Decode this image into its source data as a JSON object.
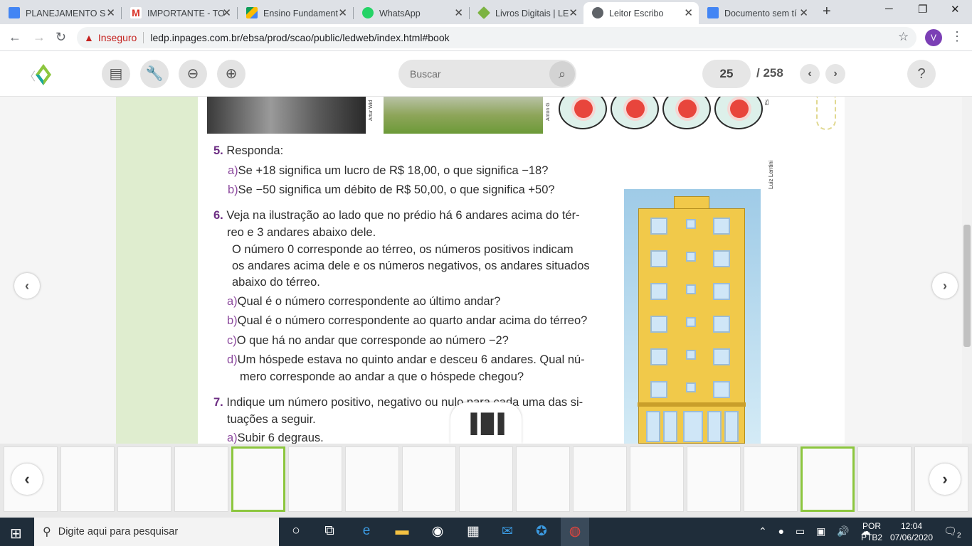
{
  "tabs": [
    {
      "title": "PLANEJAMENTO S",
      "favicon_color": "#4285f4",
      "active": false
    },
    {
      "title": "IMPORTANTE - TO",
      "favicon_color": "#d93025",
      "active": false
    },
    {
      "title": "Ensino Fundament",
      "favicon_color": "#fbbc04",
      "active": false
    },
    {
      "title": "WhatsApp",
      "favicon_color": "#25d366",
      "active": false
    },
    {
      "title": "Livros Digitais | LE",
      "favicon_color": "#7cb342",
      "active": false
    },
    {
      "title": "Leitor Escribo",
      "favicon_color": "#5f6368",
      "active": true
    },
    {
      "title": "Documento sem tí",
      "favicon_color": "#4285f4",
      "active": false
    }
  ],
  "address": {
    "security_label": "Inseguro",
    "url": "ledp.inpages.com.br/ebsa/prod/scao/public/ledweb/index.html#book",
    "avatar_letter": "V"
  },
  "reader_toolbar": {
    "search_placeholder": "Buscar",
    "current_page": "25",
    "total_pages": "/ 258",
    "help_label": "?"
  },
  "page": {
    "credits": {
      "photo1": "Artur Wid",
      "photo2": "Anton G",
      "photo3": "Es",
      "building": "Luiz Lentini"
    },
    "q5": {
      "number": "5.",
      "text": "Responda:",
      "a": {
        "letter": "a)",
        "text": "Se +18 significa um lucro de R$ 18,00, o que significa −18?"
      },
      "b": {
        "letter": "b)",
        "text": "Se −50 significa um débito de R$ 50,00, o que significa +50?"
      }
    },
    "q6": {
      "number": "6.",
      "line1": "Veja na ilustração ao lado que no prédio há 6 andares acima do tér-",
      "line2": "reo e 3 andares abaixo dele.",
      "p1": "O número 0 corresponde ao térreo, os números positivos indicam",
      "p2": "os andares acima dele e os números negativos, os andares situados",
      "p3": "abaixo do térreo.",
      "a": {
        "letter": "a)",
        "text": "Qual é o número correspondente ao último andar?"
      },
      "b": {
        "letter": "b)",
        "text": "Qual é o número correspondente ao quarto andar acima do térreo?"
      },
      "c": {
        "letter": "c)",
        "text": "O que há no andar que corresponde ao número −2?"
      },
      "d": {
        "letter": "d)",
        "text1": "Um hóspede estava no quinto andar e desceu 6 andares. Qual nú-",
        "text2": "mero corresponde ao andar a que o hóspede chegou?"
      }
    },
    "q7": {
      "number": "7.",
      "line1": "Indique um número positivo, negativo ou nulo para cada uma das si-",
      "line2": "tuações a seguir.",
      "a": {
        "letter": "a)",
        "text": "Subir 6 degraus."
      }
    }
  },
  "taskbar": {
    "search_placeholder": "Digite aqui para pesquisar",
    "lang_top": "POR",
    "lang_bottom": "PTB2",
    "time": "12:04",
    "date": "07/06/2020",
    "notifications": "2"
  }
}
